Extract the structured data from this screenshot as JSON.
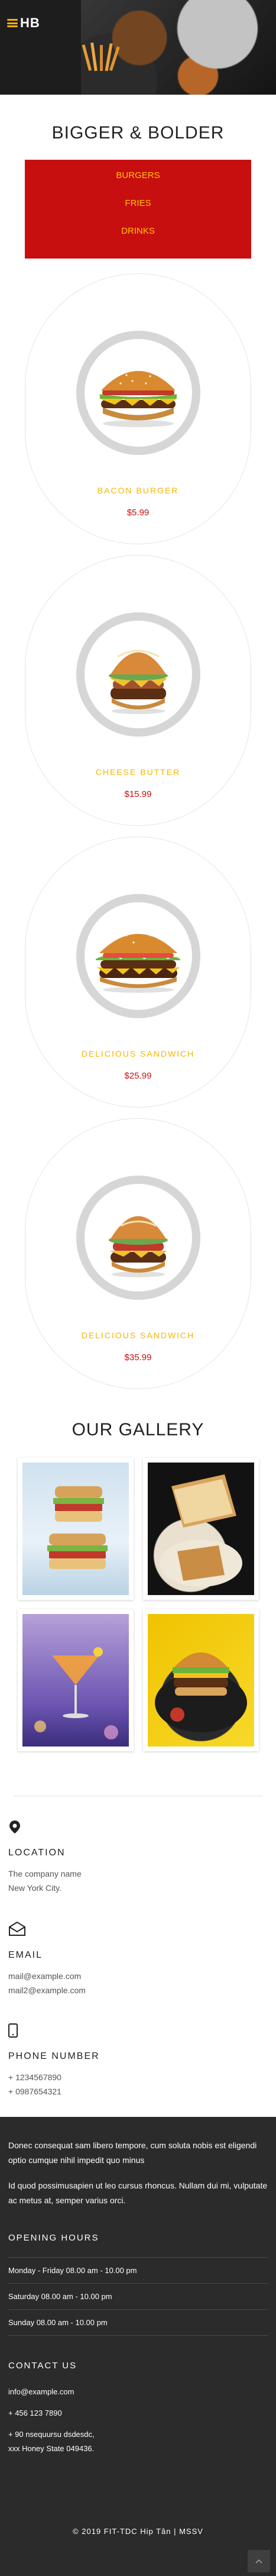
{
  "brand": {
    "logo_text": "HB",
    "accent": "#f7b20c",
    "red": "#c70f0f"
  },
  "hero": {
    "title": "BIGGER & BOLDER"
  },
  "menu": {
    "items": [
      "BURGERS",
      "FRIES",
      "DRINKS"
    ]
  },
  "products": [
    {
      "name": "BACON BURGER",
      "price": "$5.99"
    },
    {
      "name": "CHEESE BUTTER",
      "price": "$15.99"
    },
    {
      "name": "DELICIOUS SANDWICH",
      "price": "$25.99"
    },
    {
      "name": "DELICIOUS SANDWICH",
      "price": "$35.99"
    }
  ],
  "gallery": {
    "title": "OUR GALLERY"
  },
  "contacts": {
    "location": {
      "label": "LOCATION",
      "lines": [
        "The company name",
        "New York City."
      ]
    },
    "email": {
      "label": "EMAIL",
      "lines": [
        "mail@example.com",
        "mail2@example.com"
      ]
    },
    "phone": {
      "label": "PHONE NUMBER",
      "lines": [
        "+ 1234567890",
        "+ 0987654321"
      ]
    }
  },
  "footer": {
    "para1": "Donec consequat sam libero tempore, cum soluta nobis est eligendi optio cumque nihil impedit quo minus",
    "para2": "Id quod possimusapien ut leo cursus rhoncus. Nullam dui mi, vulputate ac metus at, semper varius orci.",
    "hours_title": "OPENING HOURS",
    "hours": [
      "Monday - Friday 08.00 am - 10.00 pm",
      "Saturday 08.00 am - 10.00 pm",
      "Sunday 08.00 am - 10.00 pm"
    ],
    "contact_title": "CONTACT US",
    "contact_email": "info@example.com",
    "contact_phone": "+ 456 123 7890",
    "contact_address_1": "+ 90 nsequursu dsdesdc,",
    "contact_address_2": "xxx Honey State 049436.",
    "copyright": "© 2019 FIT-TDC Hip Tân | MSSV"
  }
}
